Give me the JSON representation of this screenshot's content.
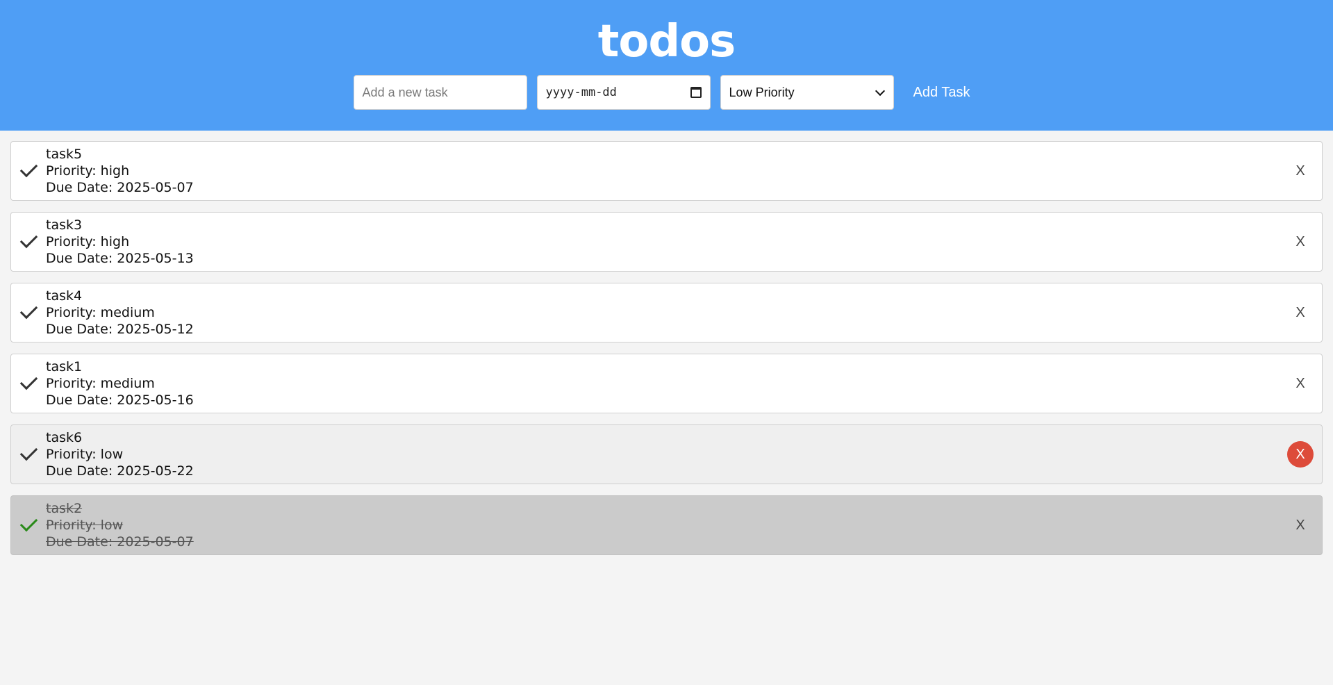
{
  "header": {
    "title": "todos"
  },
  "form": {
    "task_placeholder": "Add a new task",
    "date_value": "yyyy-mm-dd",
    "priority_selected": "Low Priority",
    "add_label": "Add Task"
  },
  "tasks": [
    {
      "name": "task5",
      "priority": "Priority: high",
      "due": "Due Date: 2025-05-07",
      "delete": "X"
    },
    {
      "name": "task3",
      "priority": "Priority: high",
      "due": "Due Date: 2025-05-13",
      "delete": "X"
    },
    {
      "name": "task4",
      "priority": "Priority: medium",
      "due": "Due Date: 2025-05-12",
      "delete": "X"
    },
    {
      "name": "task1",
      "priority": "Priority: medium",
      "due": "Due Date: 2025-05-16",
      "delete": "X"
    },
    {
      "name": "task6",
      "priority": "Priority: low",
      "due": "Due Date: 2025-05-22",
      "delete": "X"
    },
    {
      "name": "task2",
      "priority": "Priority: low",
      "due": "Due Date: 2025-05-07",
      "delete": "X"
    }
  ],
  "colors": {
    "header_bg": "#4f9ef5",
    "delete_hover": "#dd4b3a",
    "completed_check": "#2a8a1a"
  }
}
